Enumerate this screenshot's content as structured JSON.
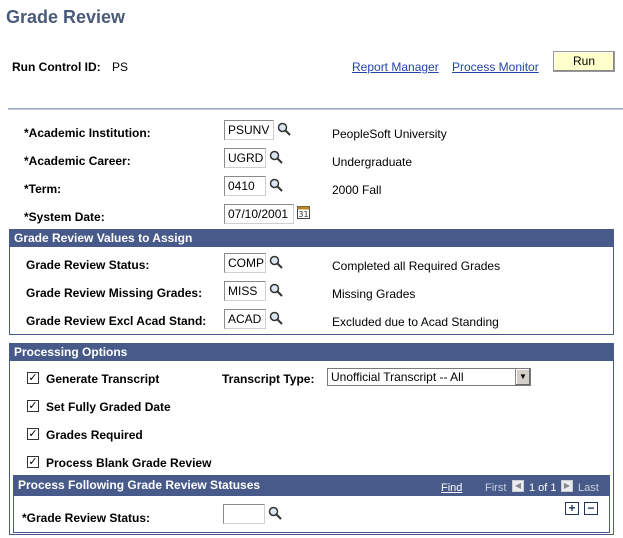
{
  "page": {
    "title": "Grade Review",
    "run_control_label": "Run Control ID:",
    "run_control_value": "PS",
    "report_manager": "Report Manager",
    "process_monitor": "Process Monitor",
    "run": "Run"
  },
  "criteria": {
    "institution_label": "*Academic Institution:",
    "institution_value": "PSUNV",
    "institution_desc": "PeopleSoft University",
    "career_label": "*Academic Career:",
    "career_value": "UGRD",
    "career_desc": "Undergraduate",
    "term_label": "*Term:",
    "term_value": "0410",
    "term_desc": "2000 Fall",
    "date_label": "*System Date:",
    "date_value": "07/10/2001"
  },
  "values_section": {
    "header": "Grade Review Values to Assign",
    "status_label": "Grade Review Status:",
    "status_value": "COMP",
    "status_desc": "Completed all Required Grades",
    "missing_label": "Grade Review Missing Grades:",
    "missing_value": "MISS",
    "missing_desc": "Missing Grades",
    "excl_label": "Grade Review Excl Acad Stand:",
    "excl_value": "ACAD",
    "excl_desc": "Excluded due to Acad Standing"
  },
  "processing": {
    "header": "Processing Options",
    "gen_transcript": "Generate Transcript",
    "transcript_type_label": "Transcript Type:",
    "transcript_type_value": "Unofficial Transcript -- All",
    "fully_graded": "Set Fully Graded Date",
    "grades_required": "Grades Required",
    "blank_review": "Process Blank Grade Review",
    "checked": "✓"
  },
  "statuses": {
    "header": "Process Following Grade Review Statuses",
    "find": "Find",
    "first": "First",
    "range": "1 of 1",
    "last": "Last",
    "status_label": "*Grade Review Status:",
    "status_value": "",
    "add": "+",
    "remove": "−"
  }
}
